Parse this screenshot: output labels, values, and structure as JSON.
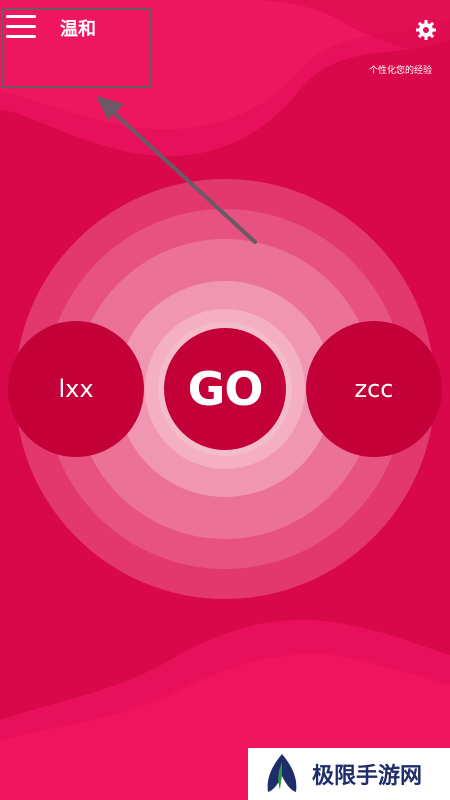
{
  "header": {
    "title": "温和",
    "subtitle": "个性化您的经验",
    "menu_icon": "hamburger-menu-icon",
    "settings_icon": "gear-icon"
  },
  "players": {
    "left": "lxx",
    "right": "zcc"
  },
  "go_button": {
    "label": "GO"
  },
  "watermark": {
    "text": "极限手游网"
  },
  "colors": {
    "background": "#d8084a",
    "player_circle": "#c40039",
    "ring_light": "#f4bccb",
    "highlight_box": "#6b5a66"
  }
}
